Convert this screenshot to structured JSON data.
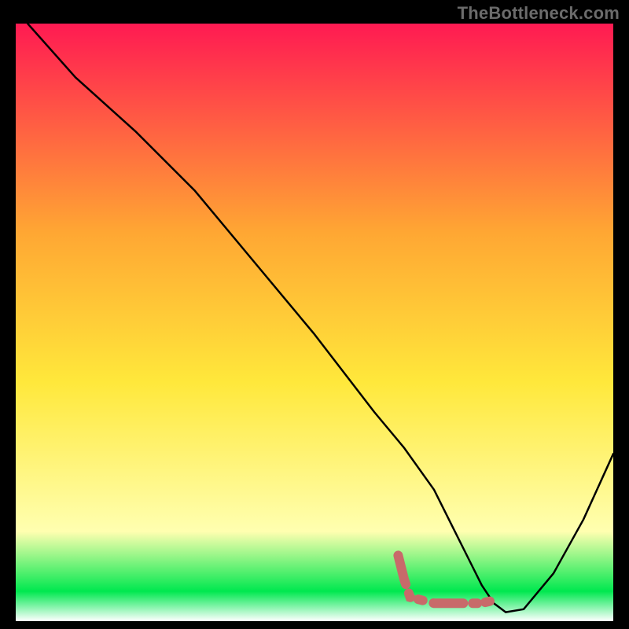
{
  "watermark": "TheBottleneck.com",
  "chart_data": {
    "type": "line",
    "title": "",
    "xlabel": "",
    "ylabel": "",
    "xlim": [
      0,
      100
    ],
    "ylim": [
      0,
      100
    ],
    "grid": false,
    "legend": false,
    "background_gradient": {
      "top": "#ff1a52",
      "upper_mid": "#ffa733",
      "mid": "#ffe83b",
      "lower": "#ffffb0",
      "band": "#00e84f",
      "bottom": "#ffffff"
    },
    "series": [
      {
        "name": "curve",
        "color": "#000000",
        "x": [
          2,
          10,
          20,
          25,
          30,
          40,
          50,
          60,
          65,
          70,
          73,
          76,
          78,
          80,
          82,
          85,
          90,
          95,
          100
        ],
        "y": [
          100,
          91,
          82,
          77,
          72,
          60,
          48,
          35,
          29,
          22,
          16,
          10,
          6,
          3,
          1.5,
          2,
          8,
          17,
          28
        ]
      },
      {
        "name": "marker-band",
        "color": "#c86a6a",
        "style": "thick-dash",
        "x": [
          64,
          65,
          66,
          70,
          74,
          78,
          80,
          81
        ],
        "y": [
          11,
          7,
          4,
          3,
          3,
          3,
          3.5,
          4
        ]
      }
    ]
  }
}
